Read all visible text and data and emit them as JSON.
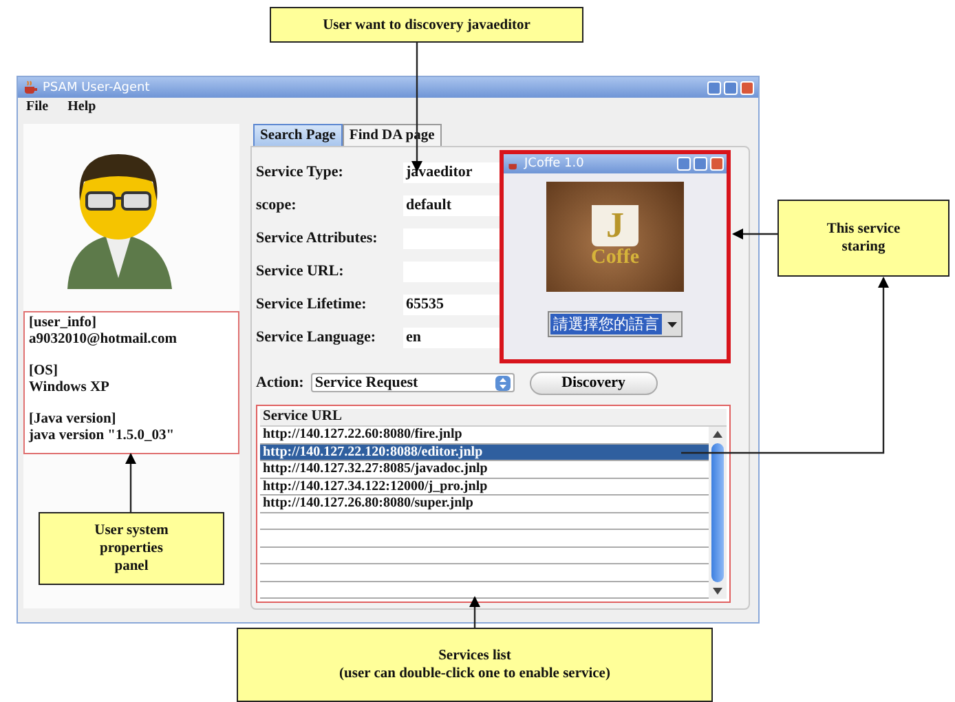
{
  "callouts": [
    {
      "text": "User want to discovery javaeditor"
    },
    {
      "text": "This service\nstaring"
    },
    {
      "text": "User system\nproperties\npanel"
    },
    {
      "text": "Services list\n(user can double-click one to enable service)"
    }
  ],
  "window": {
    "title": "PSAM User-Agent",
    "menu": [
      "File",
      "Help"
    ]
  },
  "user_info": [
    {
      "heading": "[user_info]",
      "value": "a9032010@hotmail.com"
    },
    {
      "heading": "[OS]",
      "value": "Windows XP"
    },
    {
      "heading": "[Java version]",
      "value": "java version \"1.5.0_03\""
    }
  ],
  "tabs": [
    {
      "label": "Search Page",
      "selected": true
    },
    {
      "label": "Find DA page",
      "selected": false
    }
  ],
  "fields": [
    {
      "label": "Service Type:",
      "value": "javaeditor"
    },
    {
      "label": "scope:",
      "value": "default"
    },
    {
      "label": "Service Attributes:"
    },
    {
      "label": "Service URL:"
    },
    {
      "label": "Service Lifetime:",
      "value": "65535"
    },
    {
      "label": "Service Language:",
      "value": "en"
    }
  ],
  "action": {
    "label": "Action:",
    "value": "Service Request"
  },
  "discovery_button": "Discovery",
  "services_list": {
    "header": "Service URL",
    "rows": [
      {
        "url": "http://140.127.22.60:8080/fire.jnlp",
        "selected": false
      },
      {
        "url": "http://140.127.22.120:8088/editor.jnlp",
        "selected": true
      },
      {
        "url": "http://140.127.32.27:8085/javadoc.jnlp",
        "selected": false
      },
      {
        "url": "http://140.127.34.122:12000/j_pro.jnlp",
        "selected": false
      },
      {
        "url": "http://140.127.26.80:8080/super.jnlp",
        "selected": false
      }
    ]
  },
  "popup": {
    "title": "JCoffe 1.0",
    "logo_letter": "J",
    "logo_word": "Coffe",
    "language_select": "請選擇您的語言"
  }
}
